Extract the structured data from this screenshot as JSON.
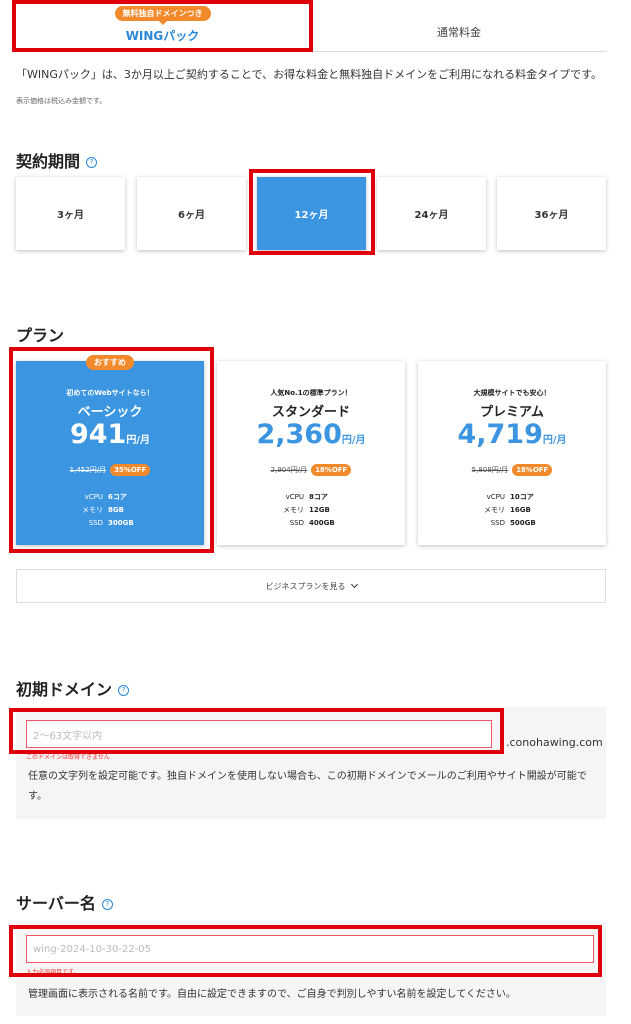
{
  "tabs": {
    "wing_badge": "無料独自ドメインつき",
    "wing_label": "WINGパック",
    "normal_label": "通常料金"
  },
  "description": "「WINGパック」は、3か月以上ご契約することで、お得な料金と無料独自ドメインをご利用になれる料金タイプです。",
  "tax_note": "表示価格は税込み金額です。",
  "period": {
    "title": "契約期間",
    "options": [
      "3ヶ月",
      "6ヶ月",
      "12ヶ月",
      "24ヶ月",
      "36ヶ月"
    ],
    "selected": "12ヶ月"
  },
  "plan": {
    "title": "プラン",
    "items": [
      {
        "tag": "おすすめ",
        "subtitle": "初めてのWebサイトなら！",
        "name": "ベーシック",
        "price": "941",
        "unit": "円/月",
        "old_price": "1,452円/月",
        "discount": "35%OFF",
        "cpu": "6コア",
        "memory": "8GB",
        "ssd": "300GB"
      },
      {
        "tag": "",
        "subtitle": "人気No.1の標準プラン！",
        "name": "スタンダード",
        "price": "2,360",
        "unit": "円/月",
        "old_price": "2,904円/月",
        "discount": "18%OFF",
        "cpu": "8コア",
        "memory": "12GB",
        "ssd": "400GB"
      },
      {
        "tag": "",
        "subtitle": "大規模サイトでも安心！",
        "name": "プレミアム",
        "price": "4,719",
        "unit": "円/月",
        "old_price": "5,808円/月",
        "discount": "18%OFF",
        "cpu": "10コア",
        "memory": "16GB",
        "ssd": "500GB"
      }
    ],
    "spec_labels": {
      "cpu": "vCPU",
      "memory": "メモリ",
      "ssd": "SSD"
    },
    "business_button": "ビジネスプランを見る"
  },
  "domain": {
    "title": "初期ドメイン",
    "placeholder": "2～63文字以内",
    "error": "このドメインは取得できません",
    "suffix": ".conohawing.com",
    "help": "任意の文字列を設定可能です。独自ドメインを使用しない場合も、この初期ドメインでメールのご利用やサイト開設が可能です。"
  },
  "server": {
    "title": "サーバー名",
    "value": "wing-2024-10-30-22-05",
    "error": "入力必須項目です。",
    "help": "管理画面に表示される名前です。自由に設定できますので、ご自身で判別しやすい名前を設定してください。"
  },
  "colors": {
    "accent": "#3b95e0",
    "badge": "#f2892b",
    "highlight_box": "#e0000b"
  }
}
